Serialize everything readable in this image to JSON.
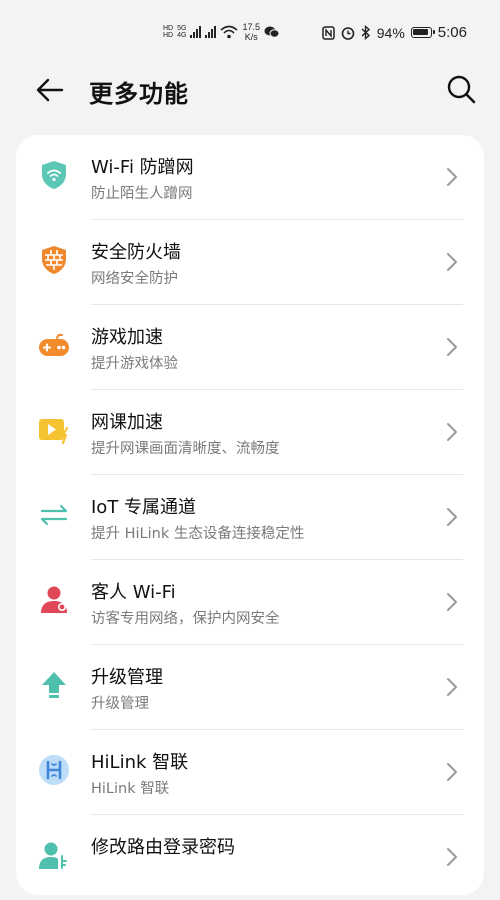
{
  "status_bar": {
    "hd1": "HD",
    "hd2": "HD",
    "net1": "5G",
    "net2": "4G",
    "speed_value": "17.5",
    "speed_unit": "K/s",
    "battery": "94%",
    "time": "5:06"
  },
  "header": {
    "title": "更多功能"
  },
  "menu": [
    {
      "title": "Wi-Fi 防蹭网",
      "subtitle": "防止陌生人蹭网",
      "icon": "wifi-shield-icon",
      "color": "#5cc7b5"
    },
    {
      "title": "安全防火墙",
      "subtitle": "网络安全防护",
      "icon": "firewall-icon",
      "color": "#f0892e"
    },
    {
      "title": "游戏加速",
      "subtitle": "提升游戏体验",
      "icon": "gamepad-icon",
      "color": "#f28b2c"
    },
    {
      "title": "网课加速",
      "subtitle": "提升网课画面清晰度、流畅度",
      "icon": "video-class-icon",
      "color": "#f5c332"
    },
    {
      "title": "IoT 专属通道",
      "subtitle": "提升 HiLink 生态设备连接稳定性",
      "icon": "iot-channel-icon",
      "color": "#4fc0ad"
    },
    {
      "title": "客人 Wi-Fi",
      "subtitle": "访客专用网络，保护内网安全",
      "icon": "guest-user-icon",
      "color": "#e0485a"
    },
    {
      "title": "升级管理",
      "subtitle": "升级管理",
      "icon": "upgrade-arrow-icon",
      "color": "#4fc0ad"
    },
    {
      "title": "HiLink 智联",
      "subtitle": "HiLink 智联",
      "icon": "hilink-icon",
      "color": "#4a8ee0"
    },
    {
      "title": "修改路由登录密码",
      "subtitle": "",
      "icon": "user-key-icon",
      "color": "#4fc0ad"
    }
  ]
}
